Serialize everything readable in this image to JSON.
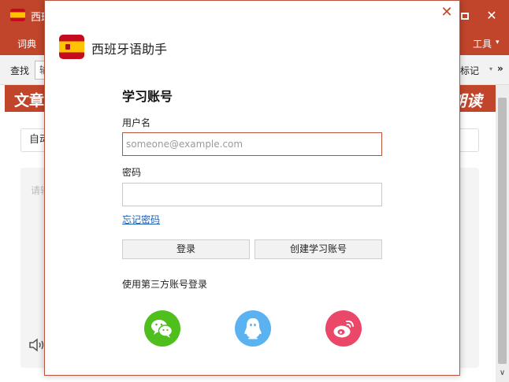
{
  "app": {
    "title": "西班",
    "menu": {
      "dict": "词典",
      "tools": "工具",
      "tools_caret": "▾"
    },
    "toolbar": {
      "search_label": "查找",
      "search_value": "输",
      "mark_label": "标记",
      "caret": "▾",
      "more": "»"
    },
    "banner": {
      "left": "文章",
      "right": "朗读"
    },
    "field_value": "自动",
    "textarea_placeholder": "请输",
    "window_close_glyph": "✕",
    "scroll_down_glyph": "∨"
  },
  "dialog": {
    "close_glyph": "✕",
    "app_name": "西班牙语助手",
    "form_title": "学习账号",
    "username_label": "用户名",
    "username_placeholder": "someone@example.com",
    "password_label": "密码",
    "forgot_link": "忘记密码",
    "login_button": "登录",
    "create_button": "创建学习账号",
    "third_party_label": "使用第三方账号登录",
    "social": [
      "wechat-icon",
      "qq-icon",
      "weibo-icon"
    ]
  },
  "colors": {
    "brand": "#c0452b",
    "link": "#1a5fb4",
    "wechat": "#4fbf1d",
    "qq": "#5ab2f1",
    "weibo": "#ea4769"
  }
}
